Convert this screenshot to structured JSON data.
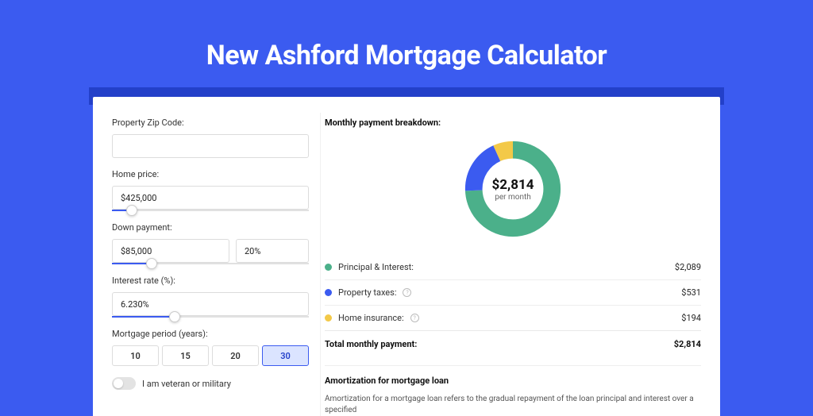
{
  "page_title": "New Ashford Mortgage Calculator",
  "form": {
    "zip_label": "Property Zip Code:",
    "zip_value": "",
    "price_label": "Home price:",
    "price_value": "$425,000",
    "price_slider_pct": 10,
    "down_label": "Down payment:",
    "down_amount": "$85,000",
    "down_pct": "20%",
    "down_slider_pct": 20,
    "rate_label": "Interest rate (%):",
    "rate_value": "6.230%",
    "rate_slider_pct": 32,
    "period_label": "Mortgage period (years):",
    "periods": [
      "10",
      "15",
      "20",
      "30"
    ],
    "period_selected": "30",
    "veteran_label": "I am veteran or military"
  },
  "breakdown": {
    "title": "Monthly payment breakdown:",
    "total_display": "$2,814",
    "total_sub": "per month",
    "items": [
      {
        "label": "Principal & Interest:",
        "value": "$2,089",
        "color": "#4bb08a",
        "info": false
      },
      {
        "label": "Property taxes:",
        "value": "$531",
        "color": "#3b5bf0",
        "info": true
      },
      {
        "label": "Home insurance:",
        "value": "$194",
        "color": "#f3c948",
        "info": true
      }
    ],
    "total_label": "Total monthly payment:",
    "total_value": "$2,814"
  },
  "chart_data": {
    "type": "pie",
    "title": "Monthly payment breakdown",
    "series": [
      {
        "name": "Principal & Interest",
        "value": 2089,
        "color": "#4bb08a"
      },
      {
        "name": "Property taxes",
        "value": 531,
        "color": "#3b5bf0"
      },
      {
        "name": "Home insurance",
        "value": 194,
        "color": "#f3c948"
      }
    ],
    "total": 2814,
    "center_label": "$2,814 per month"
  },
  "amort": {
    "title": "Amortization for mortgage loan",
    "text": "Amortization for a mortgage loan refers to the gradual repayment of the loan principal and interest over a specified"
  }
}
